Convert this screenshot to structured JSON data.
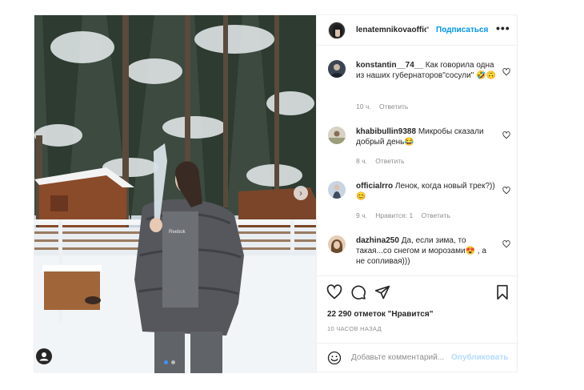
{
  "post": {
    "author": "lenatemnikovaoffic",
    "separator": "•",
    "follow_label": "Подписаться",
    "more_label": "•••"
  },
  "comments": [
    {
      "user": "konstantin__74__",
      "text": "Как говорила одна из наших губернаторов\"сосули\" 🤣🙃",
      "time": "10 ч.",
      "reply": "Ответить",
      "likes_label": ""
    },
    {
      "user": "khabibullin9388",
      "text": "Микробы сказали добрый день😂",
      "time": "8 ч.",
      "reply": "Ответить",
      "likes_label": ""
    },
    {
      "user": "officialrro",
      "text": "Ленок, когда новый трек?)) 😊",
      "time": "9 ч.",
      "reply": "Ответить",
      "likes_label": "Нравится: 1"
    },
    {
      "user": "dazhina250",
      "text": "Да, если зима, то такая...со снегом и морозами😍 , а не сопливая)))",
      "time": "",
      "reply": "",
      "likes_label": ""
    }
  ],
  "stats": {
    "likes": "22 290 отметок \"Нравится\"",
    "posted_ago": "10 ЧАСОВ НАЗАД"
  },
  "composer": {
    "placeholder": "Добавьте комментарий...",
    "publish_label": "Опубликовать"
  },
  "icons": {
    "like": "heart-icon",
    "comment": "comment-icon",
    "share": "paper-plane-icon",
    "save": "bookmark-icon",
    "emoji": "smiley-icon",
    "carousel_next": "chevron-right-icon",
    "tagged_user": "user-icon"
  },
  "carousel": {
    "slides": 2,
    "active": 1
  },
  "colors": {
    "accent": "#0095f6",
    "muted": "#8e8e8e",
    "text": "#262626"
  }
}
